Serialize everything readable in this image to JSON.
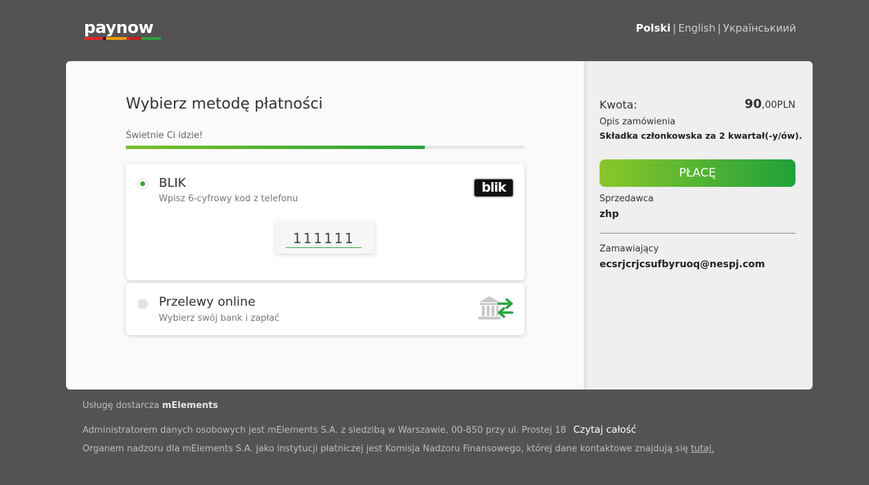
{
  "brand": {
    "logo_text": "paynow",
    "logo_colors": [
      "#e3262d",
      "#111111",
      "#f39c12",
      "#e3262d",
      "#2aa33b"
    ]
  },
  "languages": {
    "active": "Polski",
    "options": [
      "English",
      "Українськиий"
    ],
    "separator": "|"
  },
  "left": {
    "title": "Wybierz metodę płatności",
    "progress_label": "Świetnie Ci idzie!",
    "progress_value": 0.75,
    "methods": [
      {
        "name": "BLIK",
        "subtitle": "Wpisz 6-cyfrowy kod z telefonu",
        "selected": true,
        "icon": "blik-logo-icon",
        "logo_text": "blik",
        "code_value": "111111"
      },
      {
        "name": "Przelewy online",
        "subtitle": "Wybierz swój bank i zapłać",
        "selected": false,
        "icon": "bank-transfer-icon"
      }
    ]
  },
  "right": {
    "amount_label": "Kwota:",
    "amount_major": "90",
    "amount_minor": ",00",
    "amount_currency": "PLN",
    "desc_label": "Opis zamówienia",
    "desc_value": "Składka członkowska za 2 kwartał(-y/ów).",
    "pay_label": "PŁACĘ",
    "seller_label": "Sprzedawca",
    "seller_value": "zhp",
    "buyer_label": "Zamawiający",
    "buyer_value": "ecsrjcrjcsufbyruoq@nespj.com"
  },
  "footer": {
    "provider_prefix": "Usługę dostarcza",
    "provider_name": "mElements",
    "admin_text": "Administratorem danych osobowych jest mElements S.A. z siedzibą w Warszawie, 00-850 przy ul. Prostej 18",
    "read_more": "Czytaj całość",
    "supervision_text": "Organem nadzoru dla mElements S.A. jako instytucji płatniczej jest Komisja Nadzoru Finansowego, której dane kontaktowe znajdują się",
    "supervision_link": "tutaj."
  },
  "colors": {
    "background": "#545253",
    "accent_green": "#2aa33b",
    "accent_lime": "#8bc62a"
  }
}
